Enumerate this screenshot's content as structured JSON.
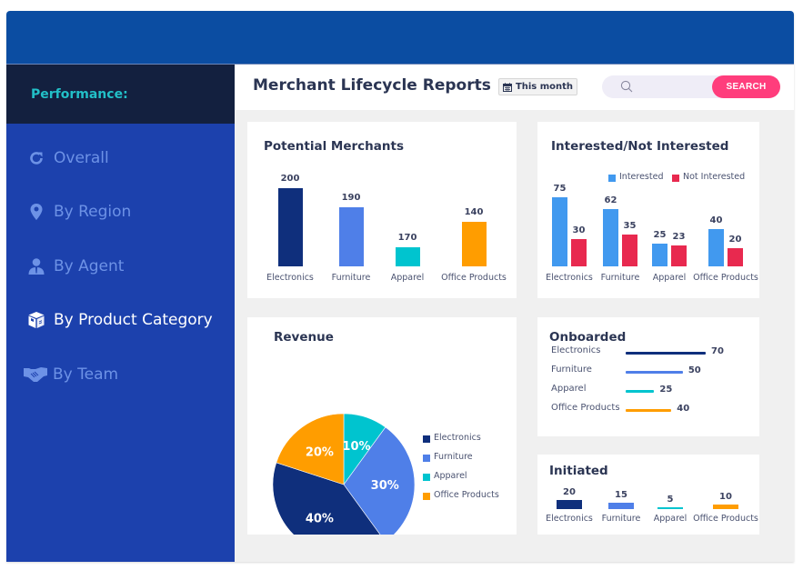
{
  "sidebar": {
    "heading": "Performance:",
    "items": [
      {
        "label": "Overall",
        "icon": "refresh-icon",
        "active": false
      },
      {
        "label": "By Region",
        "icon": "map-marker-icon",
        "active": false
      },
      {
        "label": "By Agent",
        "icon": "user-icon",
        "active": false
      },
      {
        "label": "By Product Category",
        "icon": "box-icon",
        "active": true
      },
      {
        "label": "By Team",
        "icon": "handshake-icon",
        "active": false
      }
    ]
  },
  "header": {
    "title": "Merchant Lifecycle Reports",
    "date_filter": "This month",
    "search_placeholder": "",
    "search_button": "SEARCH"
  },
  "colors": {
    "electronics": "#0f2f7c",
    "furniture": "#4f7fe8",
    "apparel": "#00c4cf",
    "office_products": "#ff9d00",
    "interested": "#4199ef",
    "not_interested": "#e8294f",
    "accent": "#ff3d7c"
  },
  "chart_data": [
    {
      "id": "potential",
      "type": "bar",
      "title": "Potential Merchants",
      "categories": [
        "Electronics",
        "Furniture",
        "Apparel",
        "Office Products"
      ],
      "values": [
        200,
        190,
        170,
        140
      ],
      "value_labels": [
        "200",
        "190",
        "170",
        "140"
      ],
      "note": "bar heights in image are not proportional to labels (bars drawn at approx. 88, 67, 22, 50 relative units)"
    },
    {
      "id": "interest",
      "type": "bar",
      "title": "Interested/Not Interested",
      "categories": [
        "Electronics",
        "Furniture",
        "Apparel",
        "Office Products"
      ],
      "legend": [
        "Interested",
        "Not Interested"
      ],
      "legend_position": "top-right",
      "series": [
        {
          "name": "Interested",
          "values": [
            75,
            62,
            25,
            40
          ]
        },
        {
          "name": "Not Interested",
          "values": [
            30,
            35,
            23,
            20
          ]
        }
      ]
    },
    {
      "id": "revenue",
      "type": "pie",
      "title": "Revenue",
      "categories": [
        "Apparel",
        "Furniture",
        "Electronics",
        "Office Products"
      ],
      "values": [
        10,
        30,
        40,
        20
      ],
      "value_labels": [
        "10%",
        "30%",
        "40%",
        "20%"
      ],
      "legend": [
        "Electronics",
        "Furniture",
        "Apparel",
        "Office Products"
      ],
      "legend_position": "right"
    },
    {
      "id": "onboarded",
      "type": "bar",
      "orientation": "horizontal",
      "title": "Onboarded",
      "categories": [
        "Electronics",
        "Furniture",
        "Apparel",
        "Office Products"
      ],
      "values": [
        70,
        50,
        25,
        40
      ]
    },
    {
      "id": "initiated",
      "type": "bar",
      "title": "Initiated",
      "categories": [
        "Electronics",
        "Furniture",
        "Apparel",
        "Office Products"
      ],
      "values": [
        20,
        15,
        5,
        10
      ]
    }
  ]
}
